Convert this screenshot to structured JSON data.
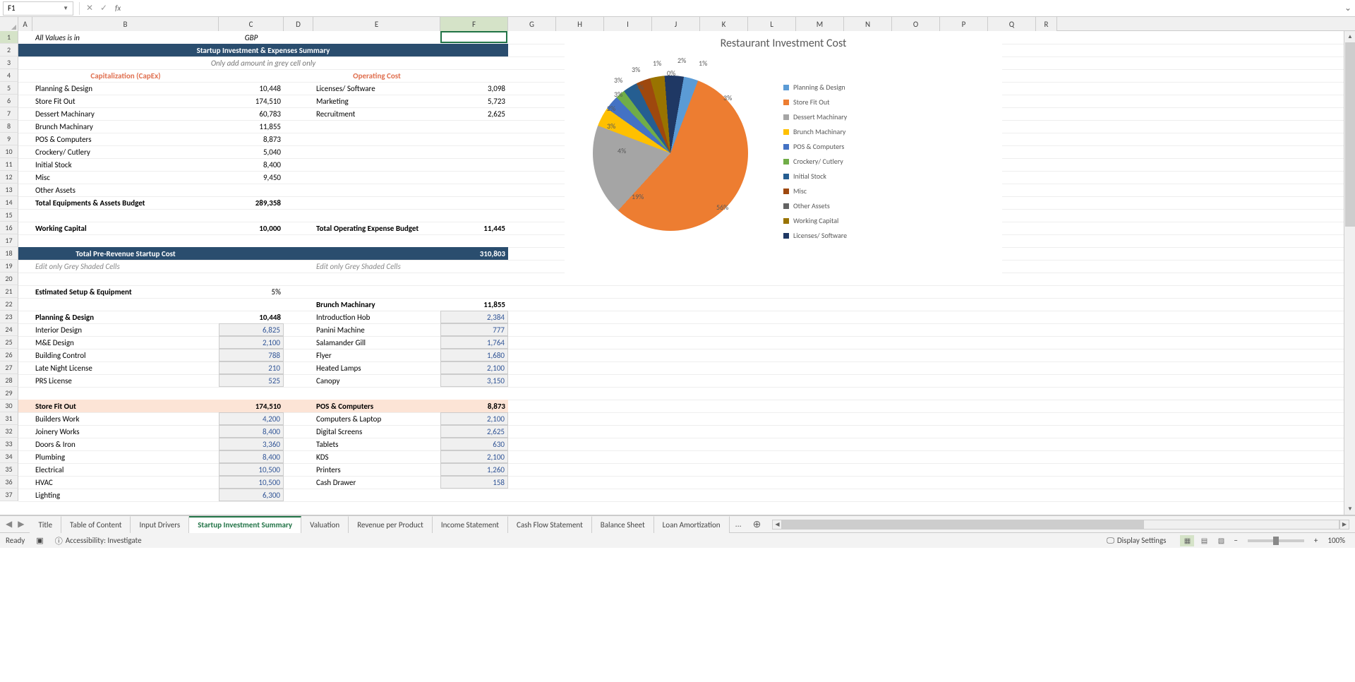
{
  "formula_bar": {
    "name_box": "F1",
    "fx": "fx",
    "value": ""
  },
  "columns": [
    "A",
    "B",
    "C",
    "D",
    "E",
    "F",
    "G",
    "H",
    "I",
    "J",
    "K",
    "L",
    "M",
    "N",
    "O",
    "P",
    "Q",
    "R"
  ],
  "col_widths": {
    "A": 20,
    "B": 264,
    "C": 92,
    "D": 42,
    "E": 180,
    "F": 96,
    "G": 68,
    "H": 68,
    "I": 68,
    "J": 68,
    "K": 68,
    "L": 68,
    "M": 68,
    "N": 68,
    "O": 68,
    "P": 68,
    "Q": 68,
    "R": 30
  },
  "selected_cell": "F1",
  "row_count": 37,
  "cells": {
    "header_note": {
      "text": "All Values is in",
      "loc": "B1",
      "style": "i c"
    },
    "currency": {
      "text": "GBP",
      "loc": "C1",
      "style": "i c"
    },
    "title": {
      "text": "Startup Investment & Expenses Summary",
      "loc": "A2:F2",
      "style": "b navy-bg c"
    },
    "subtitle": {
      "text": "Only add amount in grey cell only",
      "loc": "A3:F3",
      "style": "i c"
    },
    "capex_hdr": {
      "text": "Capitalization (CapEx)",
      "loc": "B4",
      "style": "salmon c"
    },
    "opcost_hdr": {
      "text": "Operating Cost",
      "loc": "E4",
      "style": "salmon c"
    },
    "capex_rows": [
      {
        "label": "Planning & Design",
        "val": "10,448"
      },
      {
        "label": "Store Fit Out",
        "val": "174,510"
      },
      {
        "label": "Dessert Machinary",
        "val": "60,783"
      },
      {
        "label": "Brunch Machinary",
        "val": "11,855"
      },
      {
        "label": "POS & Computers",
        "val": "8,873"
      },
      {
        "label": "Crockery/ Cutlery",
        "val": "5,040"
      },
      {
        "label": "Initial Stock",
        "val": "8,400"
      },
      {
        "label": "Misc",
        "val": "9,450"
      },
      {
        "label": "Other Assets",
        "val": ""
      }
    ],
    "opcost_rows": [
      {
        "label": "Licenses/ Software",
        "val": "3,098"
      },
      {
        "label": "Marketing",
        "val": "5,723"
      },
      {
        "label": "Recruitment",
        "val": "2,625"
      }
    ],
    "total_equip": {
      "label": "Total Equipments & Assets Budget",
      "val": "289,358"
    },
    "working_cap": {
      "label": "Working Capital",
      "val": "10,000"
    },
    "total_opex": {
      "label": "Total Operating Expense Budget",
      "val": "11,445"
    },
    "total_pre_rev": {
      "label": "Total Pre-Revenue Startup Cost",
      "val": "310,803"
    },
    "edit_note1": "Edit only Grey Shaded Cells",
    "edit_note2": "Edit only Grey Shaded Cells",
    "est_setup": {
      "label": "Estimated Setup & Equipment",
      "val": "5%"
    },
    "brunch_hdr": {
      "label": "Brunch Machinary",
      "val": "11,855"
    },
    "planning_hdr": {
      "label": "Planning & Design",
      "val": "10,448"
    },
    "planning_rows": [
      {
        "label": "Interior Design",
        "val": "6,825"
      },
      {
        "label": "M&E Design",
        "val": "2,100"
      },
      {
        "label": "Building Control",
        "val": "788"
      },
      {
        "label": "Late Night License",
        "val": "210"
      },
      {
        "label": "PRS License",
        "val": "525"
      }
    ],
    "brunch_rows": [
      {
        "label": "Introduction Hob",
        "val": "2,384"
      },
      {
        "label": "Panini Machine",
        "val": "777"
      },
      {
        "label": "Salamander Gill",
        "val": "1,764"
      },
      {
        "label": "Flyer",
        "val": "1,680"
      },
      {
        "label": "Heated Lamps",
        "val": "2,100"
      },
      {
        "label": "Canopy",
        "val": "3,150"
      }
    ],
    "store_fit_hdr": {
      "label": "Store Fit Out",
      "val": "174,510"
    },
    "pos_hdr": {
      "label": "POS & Computers",
      "val": "8,873"
    },
    "store_rows": [
      {
        "label": "Builders Work",
        "val": "4,200"
      },
      {
        "label": "Joinery Works",
        "val": "8,400"
      },
      {
        "label": "Doors & Iron",
        "val": "3,360"
      },
      {
        "label": "Plumbing",
        "val": "8,400"
      },
      {
        "label": "Electrical",
        "val": "10,500"
      },
      {
        "label": "HVAC",
        "val": "10,500"
      },
      {
        "label": "Lighting",
        "val": "6,300"
      }
    ],
    "pos_rows": [
      {
        "label": "Computers & Laptop",
        "val": "2,100"
      },
      {
        "label": "Digital Screens",
        "val": "2,625"
      },
      {
        "label": "Tablets",
        "val": "630"
      },
      {
        "label": "KDS",
        "val": "2,100"
      },
      {
        "label": "Printers",
        "val": "1,260"
      },
      {
        "label": "Cash Drawer",
        "val": "158"
      }
    ]
  },
  "chart_data": {
    "type": "pie",
    "title": "Restaurant Investment Cost",
    "series": [
      {
        "name": "Planning & Design",
        "pct": 3,
        "color": "#5b9bd5"
      },
      {
        "name": "Store Fit Out",
        "pct": 56,
        "color": "#ed7d31"
      },
      {
        "name": "Dessert Machinary",
        "pct": 19,
        "color": "#a5a5a5"
      },
      {
        "name": "Brunch Machinary",
        "pct": 4,
        "color": "#ffc000"
      },
      {
        "name": "POS & Computers",
        "pct": 3,
        "color": "#4472c4"
      },
      {
        "name": "Crockery/ Cutlery",
        "pct": 2,
        "color": "#70ad47"
      },
      {
        "name": "Initial Stock",
        "pct": 3,
        "color": "#255e91"
      },
      {
        "name": "Misc",
        "pct": 3,
        "color": "#9e480e"
      },
      {
        "name": "Other Assets",
        "pct": 0,
        "color": "#636363"
      },
      {
        "name": "Working Capital",
        "pct": 3,
        "color": "#997300"
      },
      {
        "name": "Licenses/ Software",
        "pct": 1,
        "color": "#1f3864"
      }
    ],
    "data_labels": [
      "1%",
      "2%",
      "1%",
      "3%",
      "0%",
      "3%",
      "3%",
      "3%",
      "2%",
      "3%",
      "4%",
      "19%",
      "56%",
      "3%"
    ]
  },
  "tabs": [
    "Title",
    "Table of Content",
    "Input Drivers",
    "Startup Investment Summary",
    "Valuation",
    "Revenue per Product",
    "Income Statement",
    "Cash Flow Statement",
    "Balance Sheet",
    "Loan Amortization"
  ],
  "active_tab": "Startup Investment Summary",
  "tab_more": "...",
  "status": {
    "ready": "Ready",
    "accessibility": "Accessibility: Investigate",
    "display": "Display Settings",
    "zoom": "100%"
  }
}
